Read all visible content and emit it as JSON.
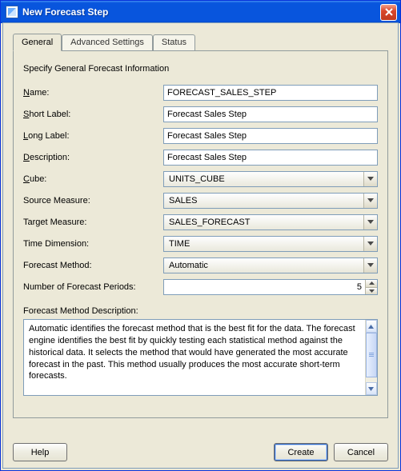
{
  "window": {
    "title": "New Forecast Step"
  },
  "tabs": {
    "general": "General",
    "advanced": "Advanced Settings",
    "status": "Status"
  },
  "intro": "Specify General Forecast Information",
  "labels": {
    "name": "Name:",
    "short_label": "Short Label:",
    "long_label": "Long Label:",
    "description": "Description:",
    "cube": "Cube:",
    "source_measure": "Source Measure:",
    "target_measure": "Target Measure:",
    "time_dimension": "Time Dimension:",
    "forecast_method": "Forecast Method:",
    "num_periods": "Number of Forecast Periods:",
    "method_desc": "Forecast Method Description:"
  },
  "values": {
    "name": "FORECAST_SALES_STEP",
    "short_label": "Forecast Sales Step",
    "long_label": "Forecast Sales Step",
    "description": "Forecast Sales Step",
    "cube": "UNITS_CUBE",
    "source_measure": "SALES",
    "target_measure": "SALES_FORECAST",
    "time_dimension": "TIME",
    "forecast_method": "Automatic",
    "num_periods": "5",
    "method_desc": "Automatic identifies the forecast method that is the best fit for the data. The forecast engine identifies the best fit by quickly testing each statistical method against the historical data. It selects the method that would have generated the most accurate forecast in the past. This method usually produces the most accurate short-term forecasts."
  },
  "buttons": {
    "help": "Help",
    "create": "Create",
    "cancel": "Cancel"
  }
}
